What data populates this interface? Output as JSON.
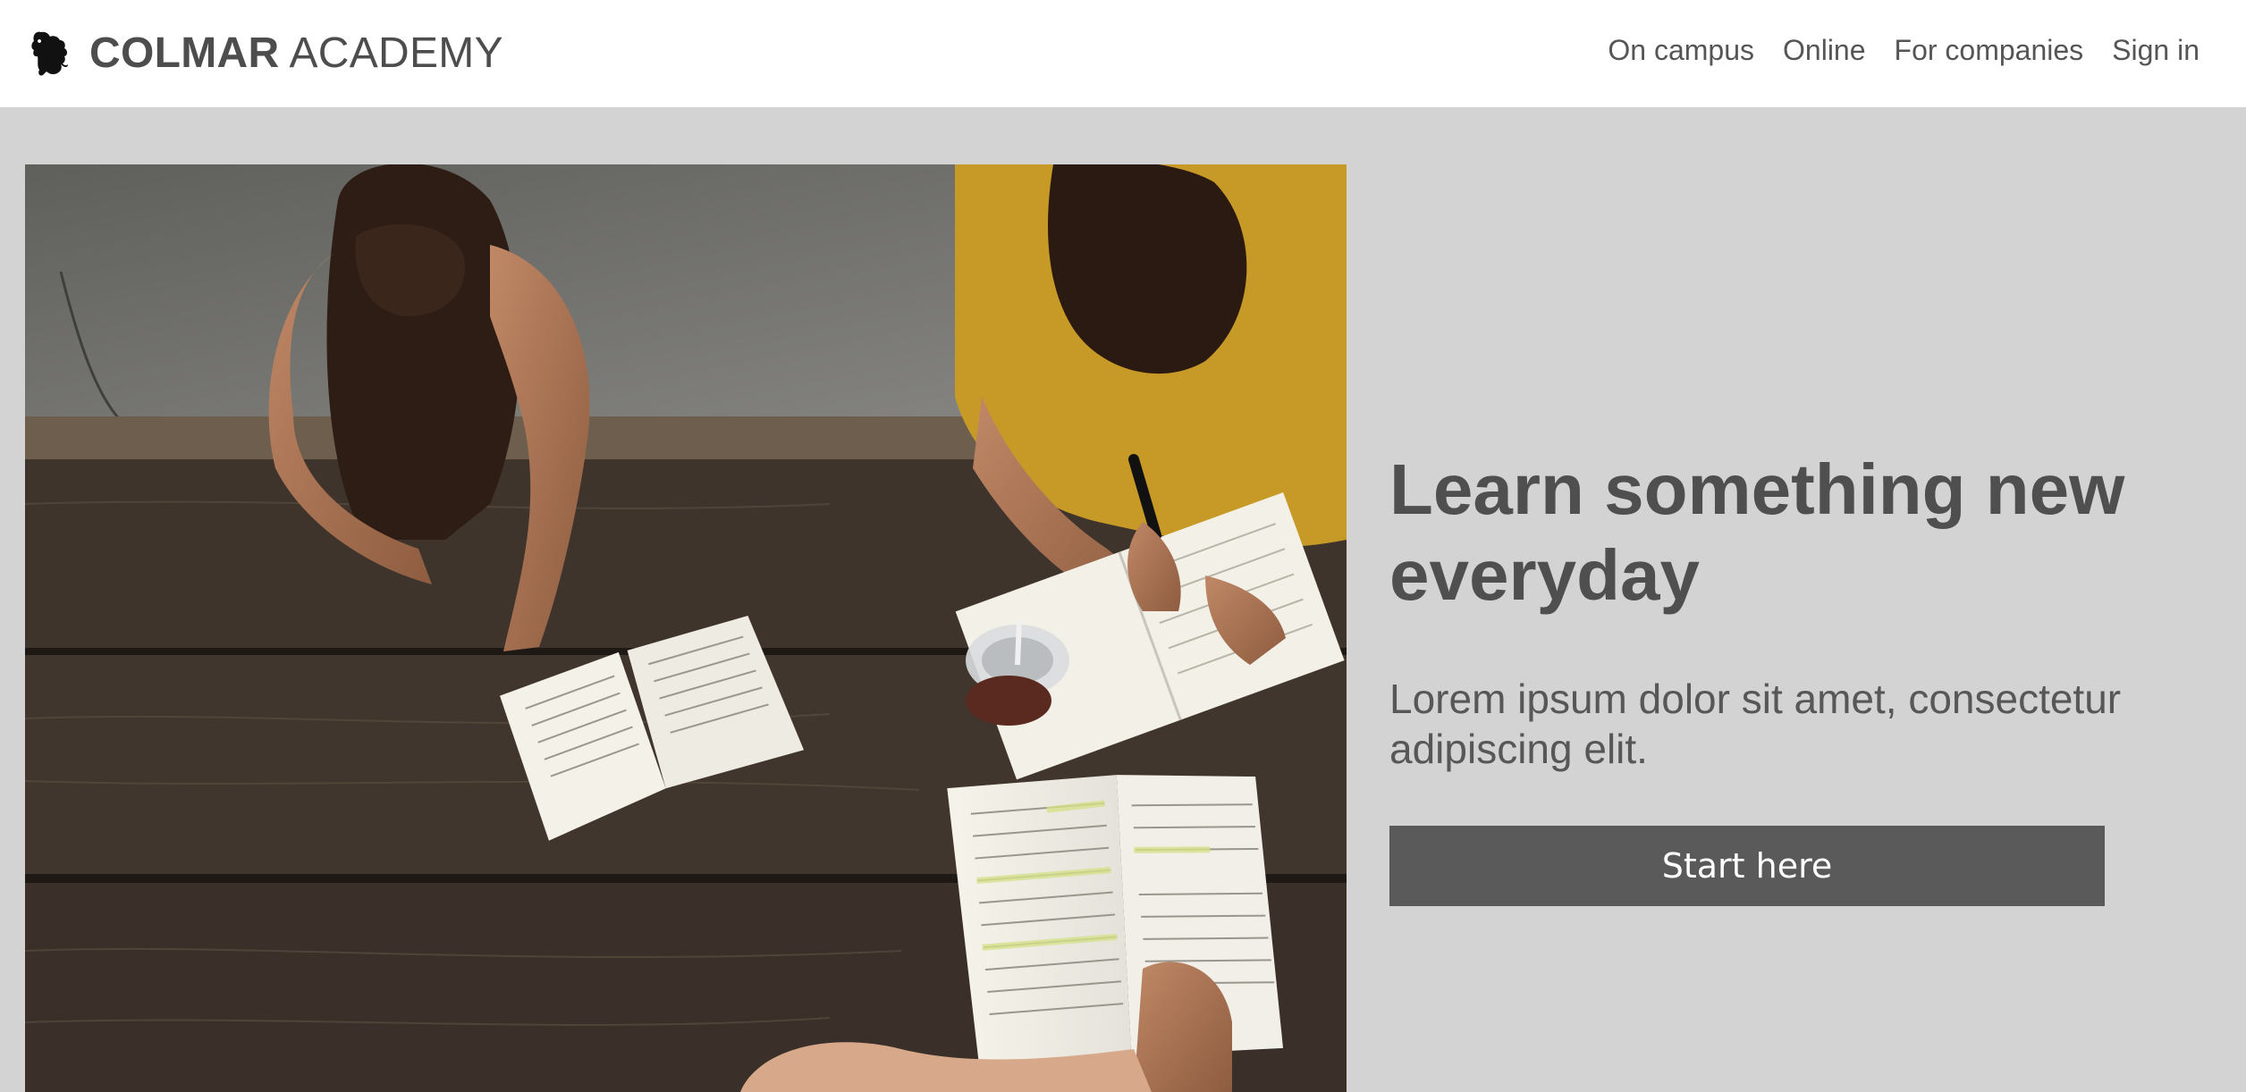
{
  "header": {
    "logo_icon": "rampant-lion-icon",
    "brand_bold": "COLMAR",
    "brand_light": "ACADEMY",
    "nav": [
      {
        "label": "On campus"
      },
      {
        "label": "Online"
      },
      {
        "label": "For companies"
      },
      {
        "label": "Sign in"
      }
    ]
  },
  "hero": {
    "image_subject": "students-studying-photo",
    "headline": "Learn something new everyday",
    "subheading": "Lorem ipsum dolor sit amet, consectetur adipiscing elit.",
    "cta_label": "Start here"
  },
  "colors": {
    "page_background": "#d3d3d3",
    "header_background": "#ffffff",
    "text": "#4f4f4f",
    "button": "#5a5a5a",
    "button_text": "#ffffff"
  }
}
